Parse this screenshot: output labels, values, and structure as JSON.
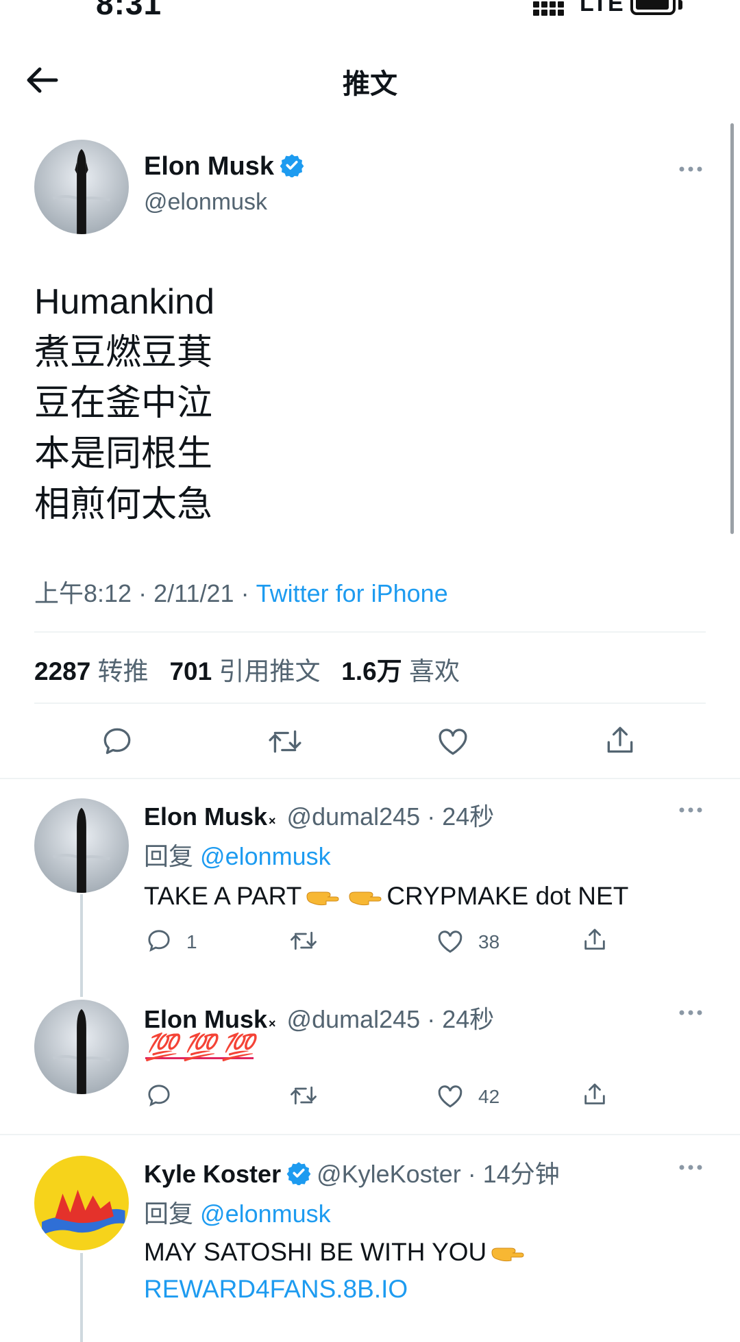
{
  "status_bar": {
    "time": "8:31",
    "network": "LTE"
  },
  "header": {
    "title": "推文"
  },
  "tweet": {
    "author_name": "Elon Musk",
    "author_handle": "@elonmusk",
    "text": "Humankind\n煮豆燃豆萁\n豆在釜中泣\n本是同根生\n相煎何太急",
    "time": "上午8:12",
    "date": "2/11/21",
    "separator": "·",
    "client": "Twitter for iPhone",
    "retweets_count": "2287",
    "retweets_label": "转推",
    "quotes_count": "701",
    "quotes_label": "引用推文",
    "likes_count": "1.6万",
    "likes_label": "喜欢"
  },
  "replies": [
    {
      "name": "Elon Musk",
      "name_suffix": "×",
      "handle": "@dumal245",
      "age": "24秒",
      "reply_prefix": "回复",
      "reply_mention": "@elonmusk",
      "text_before": "TAKE A PART",
      "text_after": "CRYPMAKE dot NET",
      "reply_count": "1",
      "like_count": "38"
    },
    {
      "name": "Elon Musk",
      "name_suffix": "×",
      "handle": "@dumal245",
      "age": "24秒",
      "emoji_text": "💯 💯 💯",
      "like_count": "42"
    },
    {
      "name": "Kyle Koster",
      "handle": "@KyleKoster",
      "age": "14分钟",
      "reply_prefix": "回复",
      "reply_mention": "@elonmusk",
      "text": "MAY SATOSHI BE WITH YOU",
      "link": "REWARD4FANS.8B.IO"
    }
  ],
  "colors": {
    "accent": "#1d9bf0",
    "secondary_text": "#536471",
    "primary_text": "#0f1419",
    "hundred_emoji": "#e0245e"
  },
  "icons": [
    "back-arrow-icon",
    "verified-badge-icon",
    "more-icon",
    "reply-icon",
    "retweet-icon",
    "like-icon",
    "share-icon",
    "pointing-hand-emoji"
  ]
}
